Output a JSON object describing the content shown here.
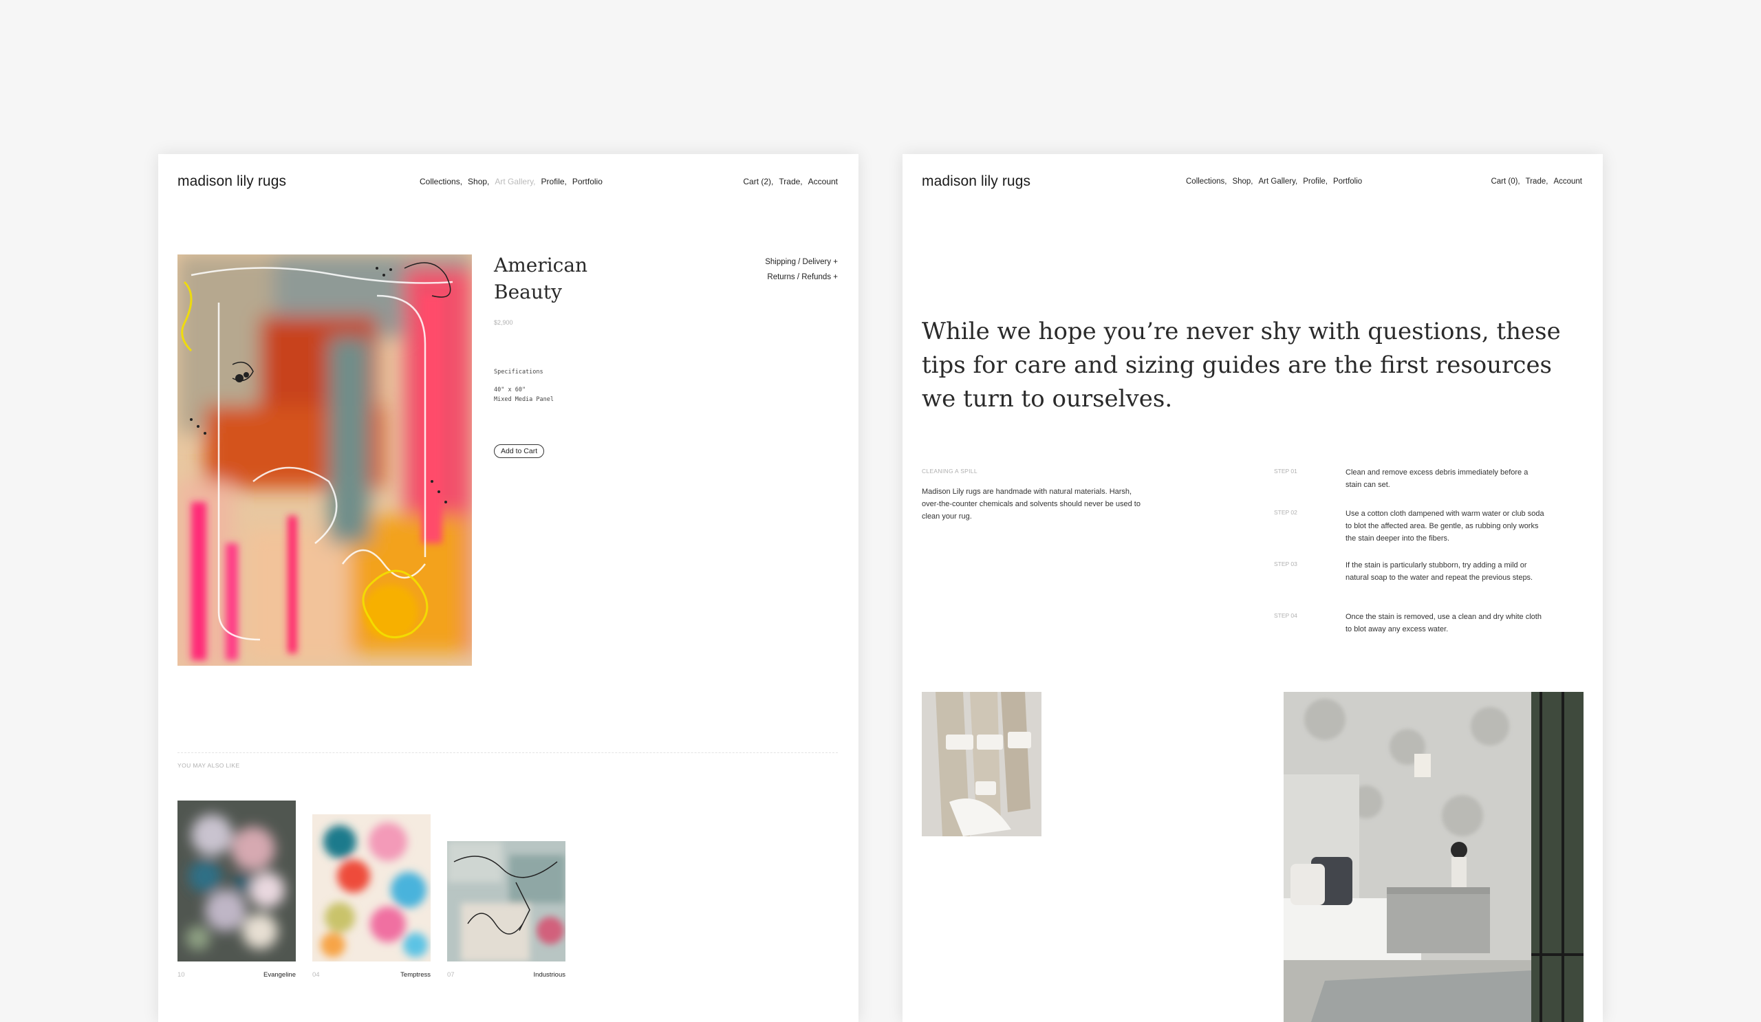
{
  "left_page": {
    "logo": "madison lily rugs",
    "nav": [
      "Collections,",
      "Shop,",
      "Art Gallery,",
      "Profile,",
      "Portfolio"
    ],
    "nav_right": [
      "Cart (2),",
      "Trade,",
      "Account"
    ],
    "product": {
      "title_line1": "American",
      "title_line2": "Beauty",
      "price": "$2,900",
      "spec_heading": "Specifications",
      "spec_size": "40\" x 60\"",
      "spec_medium": "Mixed Media Panel",
      "add_to_cart": "Add to Cart",
      "shipping": "Shipping / Delivery +",
      "returns": "Returns / Refunds +"
    },
    "related_heading": "YOU MAY ALSO LIKE",
    "related": [
      {
        "num": "10",
        "name": "Evangeline"
      },
      {
        "num": "04",
        "name": "Temptress"
      },
      {
        "num": "07",
        "name": "Industrious"
      }
    ]
  },
  "right_page": {
    "logo": "madison lily rugs",
    "nav": [
      "Collections,",
      "Shop,",
      "Art Gallery,",
      "Profile,",
      "Portfolio"
    ],
    "nav_right": [
      "Cart (0),",
      "Trade,",
      "Account"
    ],
    "intro": "While we hope you’re never shy with questions, these tips for care and sizing guides are the first resources we turn to ourselves.",
    "care_heading": "CLEANING A SPILL",
    "care_text": "Madison Lily rugs are handmade with natural materials. Harsh, over-the-counter chemicals and solvents should never be used to clean your rug.",
    "steps": [
      {
        "label": "STEP 01",
        "text": "Clean and remove excess debris immediately before a stain can set."
      },
      {
        "label": "STEP 02",
        "text": "Use a cotton cloth dampened with warm water or club soda to blot the affected area. Be gentle, as rubbing only works the stain deeper into the fibers."
      },
      {
        "label": "STEP 03",
        "text": "If the stain is particularly stubborn, try adding a mild or natural soap to the water and repeat the previous steps."
      },
      {
        "label": "STEP 04",
        "text": "Once the stain is removed, use a clean and dry white cloth to blot away any excess water."
      }
    ]
  }
}
